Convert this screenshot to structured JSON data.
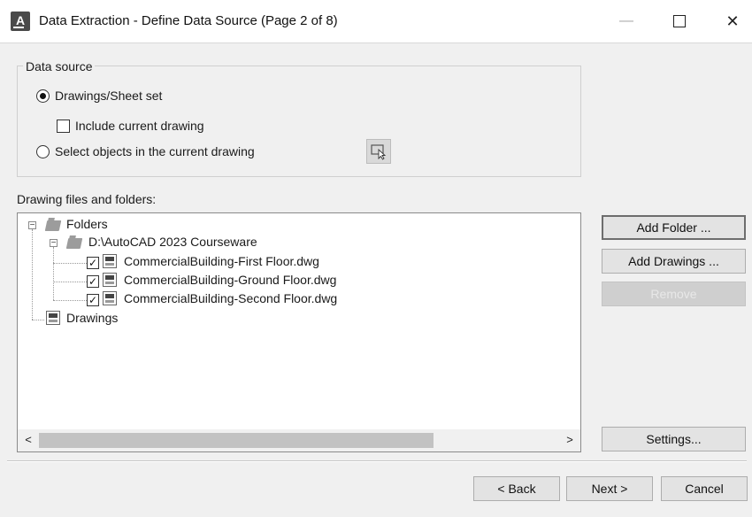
{
  "window": {
    "title": "Data Extraction - Define Data Source (Page 2 of 8)",
    "app_icon_letter": "A",
    "controls": {
      "minimize": "—",
      "maximize": "",
      "close": "✕"
    }
  },
  "data_source": {
    "legend": "Data source",
    "option_drawings": {
      "label": "Drawings/Sheet set",
      "selected": true
    },
    "include_current": {
      "label": "Include current drawing",
      "checked": false
    },
    "option_select_objects": {
      "label": "Select objects in the current drawing",
      "selected": false
    }
  },
  "files": {
    "label": "Drawing files and folders:",
    "tree": {
      "folders_label": "Folders",
      "folder_path": "D:\\AutoCAD 2023 Courseware",
      "files": [
        {
          "name": "CommercialBuilding-First Floor.dwg",
          "checked": true
        },
        {
          "name": "CommercialBuilding-Ground Floor.dwg",
          "checked": true
        },
        {
          "name": "CommercialBuilding-Second Floor.dwg",
          "checked": true
        }
      ],
      "drawings_label": "Drawings"
    },
    "scroll": {
      "left_arrow": "<",
      "right_arrow": ">"
    }
  },
  "side_buttons": {
    "add_folder": "Add Folder ...",
    "add_drawings": "Add Drawings ...",
    "remove": "Remove",
    "settings": "Settings..."
  },
  "footer": {
    "back": "< Back",
    "next": "Next >",
    "cancel": "Cancel"
  },
  "tree_glyphs": {
    "expander_open": "−",
    "check_mark": "✓"
  }
}
